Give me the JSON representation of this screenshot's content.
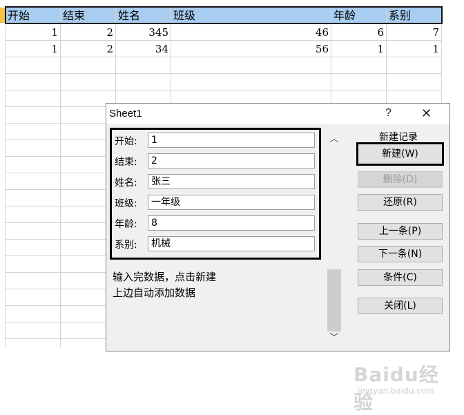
{
  "sheet": {
    "headers": [
      "开始",
      "结束",
      "姓名",
      "班级",
      "年龄",
      "系别"
    ],
    "rows": [
      [
        "1",
        "2",
        "345",
        "46",
        "6",
        "7"
      ],
      [
        "1",
        "2",
        "34",
        "56",
        "1",
        "1"
      ]
    ]
  },
  "dialog": {
    "title": "Sheet1",
    "help": "?",
    "close": "✕",
    "fields": [
      {
        "label": "开始:",
        "value": "1"
      },
      {
        "label": "结束:",
        "value": "2"
      },
      {
        "label": "姓名:",
        "value": "张三"
      },
      {
        "label": "班级:",
        "value": "一年级"
      },
      {
        "label": "年龄:",
        "value": "8"
      },
      {
        "label": "系别:",
        "value": "机械"
      }
    ],
    "info_line1": "输入完数据，点击新建",
    "info_line2": "上边自动添加数据",
    "record_label": "新建记录",
    "buttons": {
      "new": "新建(W)",
      "delete": "删除(D)",
      "restore": "还原(R)",
      "prev": "上一条(P)",
      "next": "下一条(N)",
      "criteria": "条件(C)",
      "close": "关闭(L)"
    },
    "scroll_up": "︿",
    "scroll_down": "﹀"
  },
  "watermark": {
    "logo": "Baidu经验",
    "sub": "jingyan.baidu.com"
  }
}
